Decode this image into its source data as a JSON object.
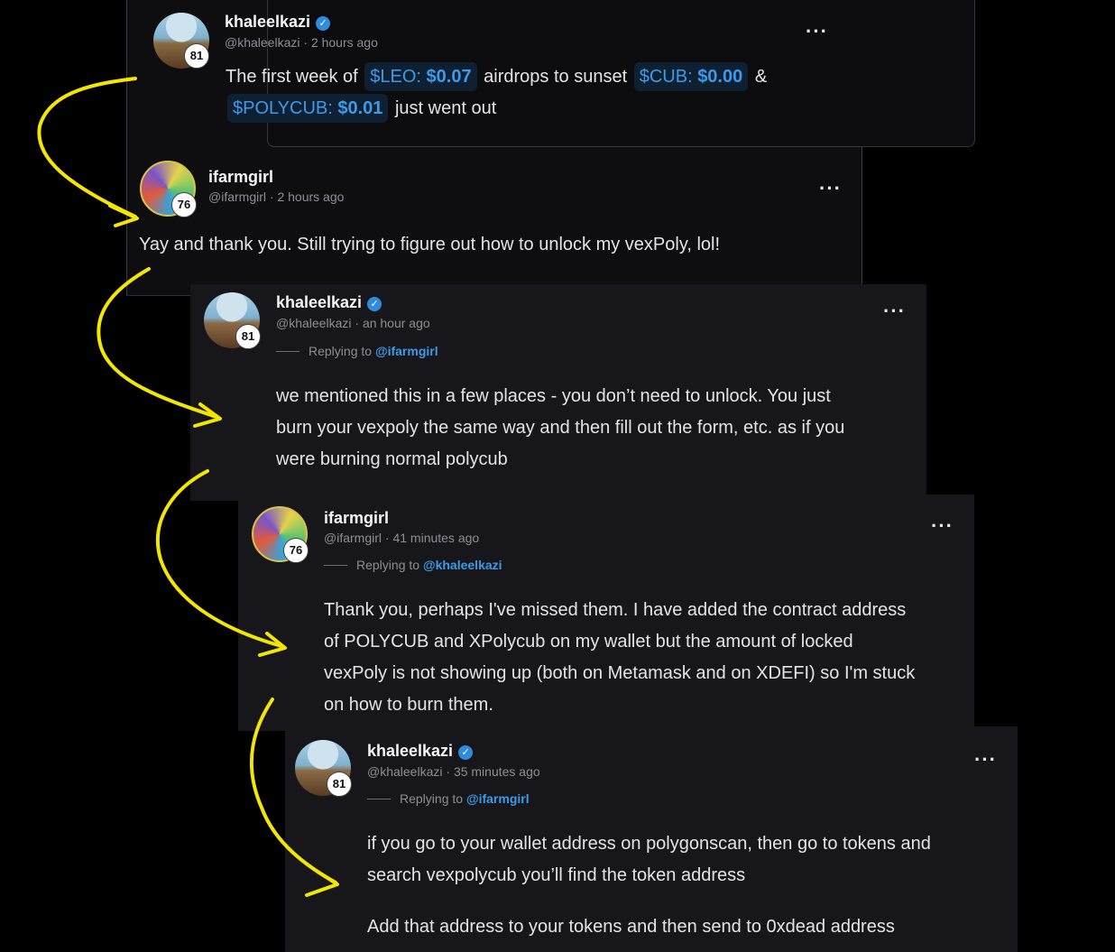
{
  "thread": [
    {
      "username": "khaleelkazi",
      "verified": true,
      "handle": "@khaleelkazi",
      "time": "2 hours ago",
      "reputation": "81",
      "body_parts": {
        "p1": "The first week of",
        "t1_sym": "$LEO:",
        "t1_val": "$0.07",
        "p2": "airdrops to sunset",
        "t2_sym": "$CUB:",
        "t2_val": "$0.00",
        "p3": "&",
        "t3_sym": "$POLYCUB:",
        "t3_val": "$0.01",
        "p4": "just went out"
      }
    },
    {
      "username": "ifarmgirl",
      "handle": "@ifarmgirl",
      "time": "2 hours ago",
      "reputation": "76",
      "body": "Yay and thank you. Still trying to figure out how to unlock my vexPoly, lol!"
    },
    {
      "username": "khaleelkazi",
      "verified": true,
      "handle": "@khaleelkazi",
      "time": "an hour ago",
      "reputation": "81",
      "replying_label": "Replying to",
      "replying_to": "@ifarmgirl",
      "body_lines": [
        "we mentioned this in a few places - you don’t need to unlock. You just",
        "burn your vexpoly the same way and then fill out the form, etc. as if you",
        "were burning normal polycub"
      ]
    },
    {
      "username": "ifarmgirl",
      "handle": "@ifarmgirl",
      "time": "41 minutes ago",
      "reputation": "76",
      "replying_label": "Replying to",
      "replying_to": "@khaleelkazi",
      "body_lines": [
        "Thank you, perhaps I've missed them. I have added the contract address",
        "of POLYCUB and XPolycub on my wallet but the amount of locked",
        "vexPoly is not showing up (both on Metamask and on XDEFI) so I'm stuck",
        "on how to burn them."
      ]
    },
    {
      "username": "khaleelkazi",
      "verified": true,
      "handle": "@khaleelkazi",
      "time": "35 minutes ago",
      "reputation": "81",
      "replying_label": "Replying to",
      "replying_to": "@ifarmgirl",
      "body_lines": [
        "if you go to your wallet address on polygonscan, then go to tokens and",
        "search vexpolycub you’ll find the token address"
      ],
      "body_line_2": "Add that address to your tokens and then send to 0xdead address"
    }
  ],
  "menu_icon": "more-options-icon",
  "colors": {
    "background": "#000000",
    "card": "#17171b",
    "link": "#3c9be8",
    "annotation": "#f3e600"
  }
}
